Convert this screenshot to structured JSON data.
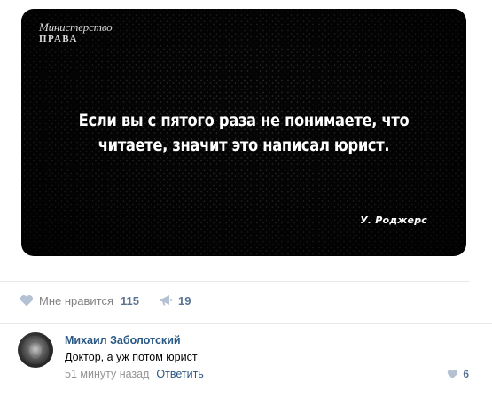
{
  "post": {
    "image": {
      "logo_line1": "Министерство",
      "logo_line2": "ПРАВА",
      "quote_line1": "Если вы с пятого раза не понимаете, что",
      "quote_line2": "читаете, значит это написал юрист.",
      "author": "У. Роджерс"
    },
    "actions": {
      "like_icon": "heart-icon",
      "like_label": "Мне нравится",
      "like_count": "115",
      "share_icon": "megaphone-icon",
      "share_count": "19"
    }
  },
  "comment": {
    "author": "Михаил Заболотский",
    "text": "Доктор, а уж потом юрист",
    "time": "51 минуту назад",
    "reply_label": "Ответить",
    "like_icon": "heart-icon",
    "like_count": "6"
  },
  "colors": {
    "link": "#2a5885",
    "count": "#5b7494",
    "muted": "#828282",
    "icon": "#b3c1d3",
    "divider": "#e7e8ec"
  }
}
